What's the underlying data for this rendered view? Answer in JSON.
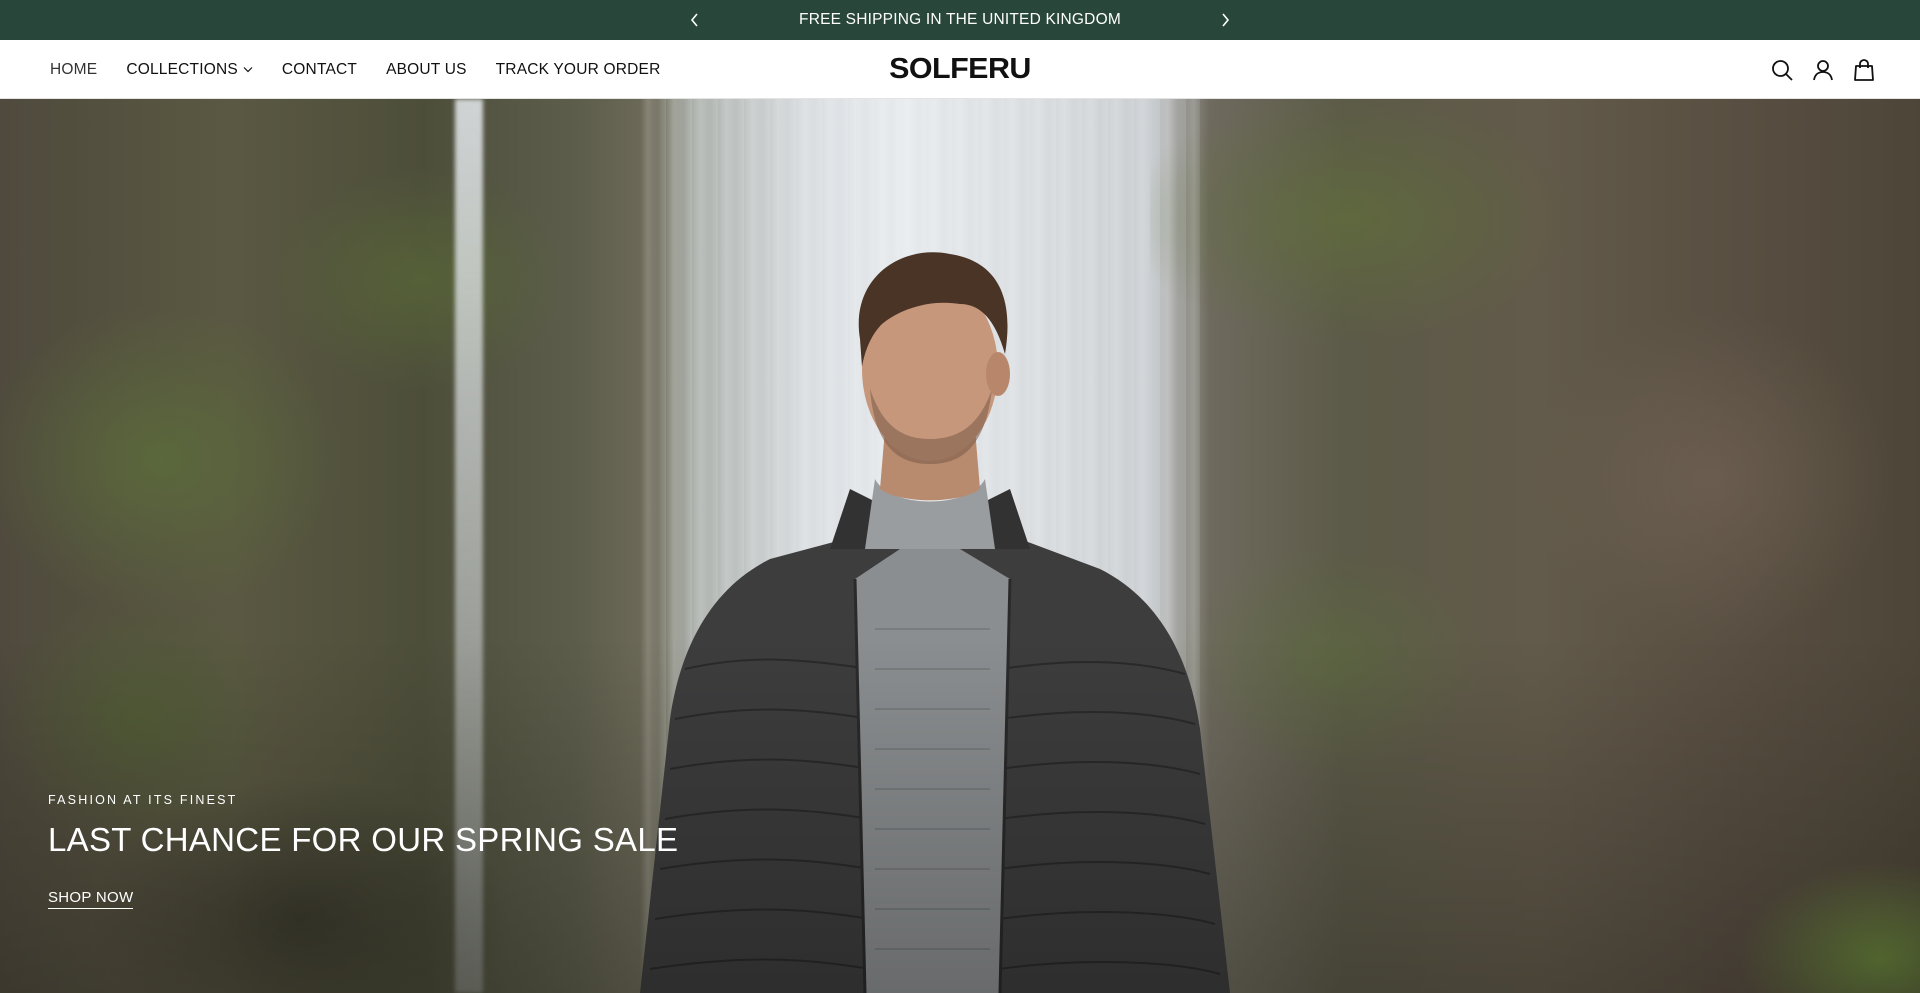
{
  "announcement": {
    "text": "FREE SHIPPING IN THE UNITED KINGDOM",
    "prev_icon": "chevron-left-icon",
    "next_icon": "chevron-right-icon",
    "background": "#28463a"
  },
  "nav": {
    "items": [
      {
        "label": "HOME",
        "active": true
      },
      {
        "label": "COLLECTIONS",
        "has_dropdown": true
      },
      {
        "label": "CONTACT"
      },
      {
        "label": "ABOUT US"
      },
      {
        "label": "TRACK YOUR ORDER"
      }
    ]
  },
  "brand": {
    "logo_text": "SOLFERU"
  },
  "header_icons": [
    "search-icon",
    "account-icon",
    "cart-icon"
  ],
  "hero": {
    "image": "man in quilted jacket and grey turtleneck in front of waterfall",
    "eyebrow": "FASHION AT ITS FINEST",
    "headline": "LAST CHANCE FOR OUR SPRING SALE",
    "cta_label": "SHOP NOW"
  }
}
